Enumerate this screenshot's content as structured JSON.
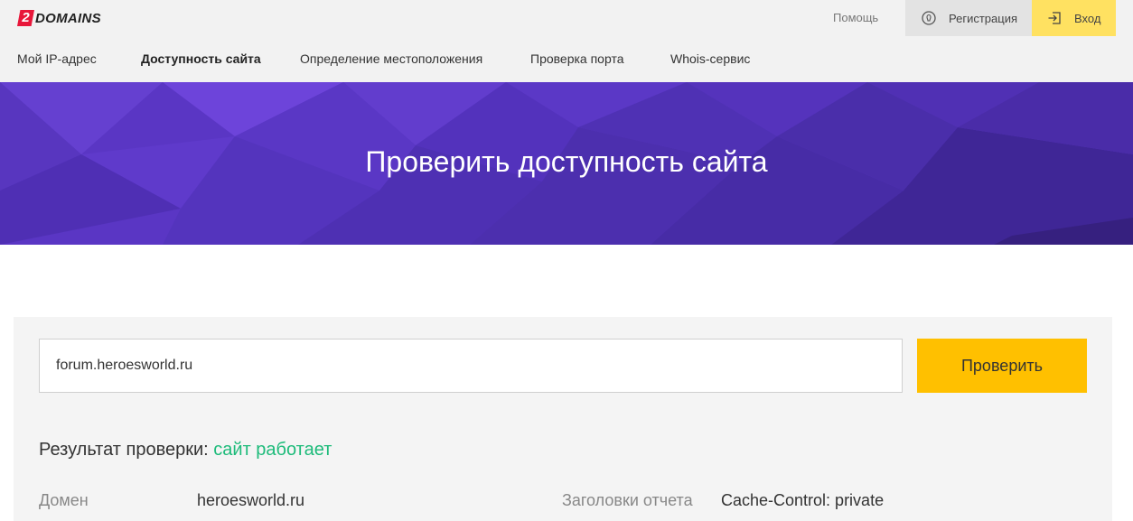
{
  "header": {
    "logo_badge": "2",
    "logo_text": "DOMAINS",
    "help": "Помощь",
    "register": "Регистрация",
    "login": "Вход"
  },
  "nav": {
    "items": [
      {
        "label": "Мой IP-адрес"
      },
      {
        "label": "Доступность сайта"
      },
      {
        "label": "Определение местоположения"
      },
      {
        "label": "Проверка порта"
      },
      {
        "label": "Whois-сервис"
      }
    ]
  },
  "hero": {
    "title": "Проверить доступность сайта"
  },
  "check": {
    "input_value": "forum.heroesworld.ru",
    "button": "Проверить"
  },
  "result": {
    "label": "Результат проверки:",
    "status": "сайт работает",
    "domain_label": "Домен",
    "domain_value": "heroesworld.ru",
    "headers_label": "Заголовки отчета",
    "headers_value": "Cache-Control: private"
  },
  "colors": {
    "accent_yellow": "#ffc000",
    "login_yellow": "#ffe161",
    "hero_purple": "#5a35c2",
    "status_green": "#1dbb7a",
    "logo_red": "#e8173a"
  }
}
